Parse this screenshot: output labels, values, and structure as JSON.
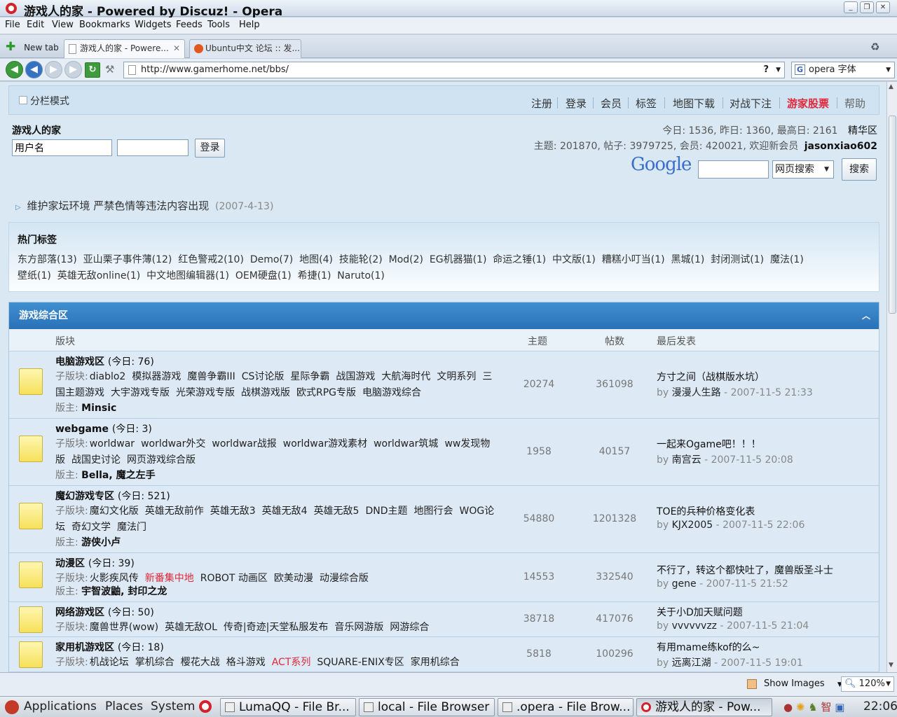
{
  "window": {
    "title": "游戏人的家 - Powered by Discuz! - Opera"
  },
  "menu": [
    "File",
    "Edit",
    "View",
    "Bookmarks",
    "Widgets",
    "Feeds",
    "Tools",
    "Help"
  ],
  "tabs": {
    "new_tab": "New tab",
    "items": [
      "游戏人的家 - Powere...",
      "Ubuntu中文 论坛 :: 发..."
    ]
  },
  "address": {
    "url": "http://www.gamerhome.net/bbs/",
    "search_value": "opera 字体",
    "help": "?"
  },
  "page": {
    "split_mode": "分栏模式",
    "nav": [
      "注册",
      "登录",
      "会员",
      "标签",
      "地图下载",
      "对战下注",
      "游家股票",
      "帮助"
    ],
    "nav_highlight_color": "#e0283a",
    "site_title": "游戏人的家",
    "username_value": "用户名",
    "login_button": "登录",
    "stats1": "今日: 1536, 昨日: 1360, 最高日: 2161",
    "elite": "精华区",
    "stats2_prefix": "主题: 201870, 帖子: 3979725, 会员: 420021, 欢迎新会员",
    "new_member": "jasonxiao602",
    "google_logo": "Google",
    "search_scope": "网页搜索",
    "search_button": "搜索",
    "announcement": "维护家坛环境 严禁色情等违法内容出现",
    "announcement_date": "(2007-4-13)",
    "tags_title": "热门标签",
    "tags_line1": "东方部落(13)  亚山栗子事件薄(12)  红色警戒2(10)  Demo(7)  地图(4)  技能轮(2)  Mod(2)  EG机器猫(1)  命运之锤(1)  中文版(1)  糟糕小叮当(1)  黑城(1)  封闭测试(1)  魔法(1)",
    "tags_line2": "壁纸(1)  英雄无敌online(1)  中文地图编辑器(1)  OEM硬盘(1)  希捷(1)  Naruto(1)",
    "section_title": "游戏综合区",
    "columns": {
      "board": "版块",
      "topics": "主题",
      "posts": "帖数",
      "last": "最后发表"
    }
  },
  "forums": [
    {
      "name": "电脑游戏区",
      "today": "(今日: 76)",
      "sub_label": "子版块:",
      "subs": [
        "diablo2",
        "模拟器游戏",
        "魔兽争霸III",
        "CS讨论版",
        "星际争霸",
        "战国游戏",
        "大航海时代",
        "文明系列",
        "三国主题游戏",
        "大宇游戏专版",
        "光荣游戏专版",
        "战棋游戏版",
        "欧式RPG专版",
        "电脑游戏综合"
      ],
      "mod_label": "版主:",
      "mods": "Minsic",
      "topics": "20274",
      "posts": "361098",
      "last_title": "方寸之间（战棋版水坑）",
      "last_by": "by",
      "last_user": "漫漫人生路",
      "last_time": "- 2007-11-5 21:33"
    },
    {
      "name": "webgame",
      "today": "(今日: 3)",
      "sub_label": "子版块:",
      "subs": [
        "worldwar",
        "worldwar外交",
        "worldwar战报",
        "worldwar游戏素材",
        "worldwar筑城",
        "ww发现物版",
        "战国史讨论",
        "网页游戏综合版"
      ],
      "mod_label": "版主:",
      "mods": "Bella, 魔之左手",
      "topics": "1958",
      "posts": "40157",
      "last_title": "一起来Ogame吧！！！",
      "last_by": "by",
      "last_user": "南宫云",
      "last_time": "- 2007-11-5 20:08"
    },
    {
      "name": "魔幻游戏专区",
      "today": "(今日: 521)",
      "sub_label": "子版块:",
      "subs": [
        "魔幻文化版",
        "英雄无敌前作",
        "英雄无敌3",
        "英雄无敌4",
        "英雄无敌5",
        "DND主题",
        "地图行会",
        "WOG论坛",
        "奇幻文学",
        "魔法门"
      ],
      "mod_label": "版主:",
      "mods": "游侠小卢",
      "topics": "54880",
      "posts": "1201328",
      "last_title": "TOE的兵种价格变化表",
      "last_by": "by",
      "last_user": "KJX2005",
      "last_time": "- 2007-11-5 22:06"
    },
    {
      "name": "动漫区",
      "today": "(今日: 39)",
      "sub_label": "子版块:",
      "subs": [
        "火影疾风传",
        "新番集中地",
        "ROBOT 动画区",
        "欧美动漫",
        "动漫综合版"
      ],
      "mod_label": "版主:",
      "mods": "宇智波鼬, 封印之龙",
      "topics": "14553",
      "posts": "332540",
      "last_title": "不行了，转这个都快吐了，魔兽版圣斗士",
      "last_by": "by",
      "last_user": "gene",
      "last_time": "- 2007-11-5 21:52"
    },
    {
      "name": "网络游戏区",
      "today": "(今日: 50)",
      "sub_label": "子版块:",
      "subs": [
        "魔兽世界(wow)",
        "英雄无敌OL",
        "传奇|奇迹|天堂私服发布",
        "音乐网游版",
        "网游综合"
      ],
      "mod_label": "",
      "mods": "",
      "topics": "38718",
      "posts": "417076",
      "last_title": "关于小D加天赋问题",
      "last_by": "by",
      "last_user": "vvvvvvzz",
      "last_time": "- 2007-11-5 21:04"
    },
    {
      "name": "家用机游戏区",
      "today": "(今日: 18)",
      "sub_label": "子版块:",
      "subs": [
        "机战论坛",
        "掌机综合",
        "樱花大战",
        "格斗游戏",
        "ACT系列",
        "SQUARE-ENIX专区",
        "家用机综合"
      ],
      "mod_label": "",
      "mods": "",
      "topics": "5818",
      "posts": "100296",
      "last_title": "有用mame练kof的么~",
      "last_by": "by",
      "last_user": "远离江湖",
      "last_time": "- 2007-11-5 19:01"
    }
  ],
  "status": {
    "show_images": "Show Images",
    "zoom": "120%"
  },
  "taskbar": {
    "apps": [
      "Applications",
      "Places",
      "System"
    ],
    "windows": [
      "LumaQQ - File Br...",
      "local - File Browser",
      ".opera - File Brow...",
      "游戏人的家 - Pow..."
    ],
    "clock": "22:06"
  }
}
